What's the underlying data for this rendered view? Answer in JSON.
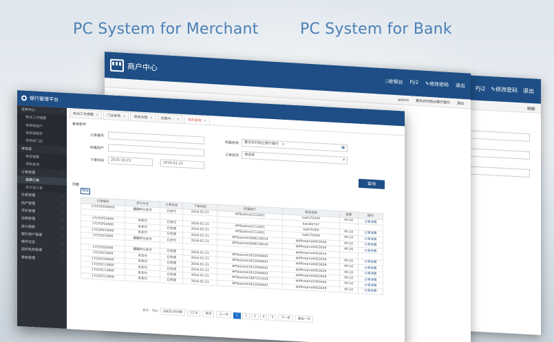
{
  "headings": {
    "merchant": "PC System for Merchant",
    "bank": "PC System for Bank"
  },
  "bank_window": {
    "top_links": [
      "Pji2",
      "✎修改密码",
      "退出"
    ],
    "refresh": "刷新"
  },
  "merchant_window": {
    "title": "商户中心",
    "top_links": [
      "⍈收银台",
      "Pji2",
      "✎修改密码",
      "退出"
    ],
    "strip_user": "admin",
    "strip_bank": "重庆农村商业银行银行",
    "strip_exit": "退出"
  },
  "platform": {
    "title": "银行管理平台",
    "sidebar": [
      {
        "label": "任务中心",
        "type": "group"
      },
      {
        "label": "电话工作提醒",
        "type": "sub"
      },
      {
        "label": "待审核商户",
        "type": "sub"
      },
      {
        "label": "待审核服务",
        "type": "sub"
      },
      {
        "label": "待审核门店",
        "type": "sub"
      },
      {
        "label": "审核提",
        "type": "group"
      },
      {
        "label": "审核提醒",
        "type": "sub"
      },
      {
        "label": "退款查询",
        "type": "sub"
      },
      {
        "label": "订单管理",
        "type": "group"
      },
      {
        "label": "逾期订单",
        "type": "sub",
        "active": true
      },
      {
        "label": "支付宝订单",
        "type": "sub"
      },
      {
        "label": "交易管理",
        "type": "group"
      },
      {
        "label": "商户管理",
        "type": "group"
      },
      {
        "label": "评价管理",
        "type": "group"
      },
      {
        "label": "店面管理",
        "type": "group"
      },
      {
        "label": "统计报表",
        "type": "group"
      },
      {
        "label": "银行用户管理",
        "type": "group"
      },
      {
        "label": "操作日志",
        "type": "group"
      },
      {
        "label": "组织机构管理",
        "type": "group"
      },
      {
        "label": "角色管理",
        "type": "group"
      }
    ],
    "tabs": [
      {
        "label": "电话工作提醒",
        "active": false
      },
      {
        "label": "门店审核",
        "active": false
      },
      {
        "label": "审核流程",
        "active": false
      },
      {
        "label": "加载中...",
        "active": false
      },
      {
        "label": "综合查询",
        "active": true
      }
    ],
    "search": {
      "section": "查询条件",
      "order_no_label": "订单编号",
      "merchant_label": "所属商户",
      "time_label": "下单时间",
      "start_date": "2015-10-23",
      "end_date": "2016-01-21",
      "org_label": "所属机构",
      "org_value": "重庆农村商业银行银行",
      "status_label": "订单状态",
      "status_value": "请选择",
      "query_btn": "查询"
    },
    "list": {
      "section": "列表",
      "export_btn": "导出",
      "columns": [
        "订单编号",
        "支付方式",
        "订单状态",
        "下单时间",
        "所属商户",
        "商品名称",
        "金额",
        "操作"
      ],
      "rows": [
        [
          "17CF5P039000",
          "翻翻时分支付",
          "已支付",
          "2016-01-21",
          "APSbatme2112001",
          "batl170204",
          "¥0.20",
          "订单详情"
        ],
        [
          "",
          "",
          "",
          "",
          "",
          "bat365747",
          "",
          ""
        ],
        [
          "17CF5PC0000",
          "未支付",
          "已支付",
          "2016-01-21",
          "APSbatme2112001",
          "batl70204",
          "¥0.10",
          "订单详情"
        ],
        [
          "17CF5P03000",
          "未支付",
          "已完成",
          "2016-01-21",
          "APSbatme2112001",
          "batl170204",
          "¥0.10",
          "订单详情"
        ],
        [
          "17CD0053000",
          "未支付",
          "已完成",
          "2016-01-21",
          "APSbosme2006130014",
          "apl6osqmo0423030",
          "¥0.10",
          "订单详情"
        ],
        [
          "17CD3C0000",
          "翻翻时分支付",
          "已支付",
          "2016-01-21",
          "APSbosme2006130014",
          "apl6osqmo0423030",
          "¥0.20",
          "订单详情"
        ],
        [
          "",
          "",
          "",
          "",
          "",
          "apl6osqmo0423015",
          "",
          ""
        ],
        [
          "17CD3Q3000",
          "翻翻时分支付",
          "已完成",
          "2016-01-21",
          "APSbosme1912044443",
          "apl6osqmo0423029",
          "¥0.10",
          "订单详情"
        ],
        [
          "17CD5C0000",
          "未支付",
          "已完成",
          "2016-01-21",
          "APSbosme1912044443",
          "apl6osqmo0423029",
          "¥0.10",
          "订单详情"
        ],
        [
          "17CD5C00000",
          "未支付",
          "已完成",
          "2016-01-21",
          "APSbosme1912044443",
          "apl6osqmo0423029",
          "¥0.10",
          "订单详情"
        ],
        [
          "17CD5C12800",
          "未支付",
          "已完成",
          "2016-01-21",
          "APSbosme1912044443",
          "apl6osqmo0423029",
          "¥0.10",
          "订单详情"
        ],
        [
          "17CD5C12800",
          "未支付",
          "已完成",
          "2016-01-21",
          "APSbosme1987211529",
          "apl6osqmo1043444",
          "¥0.10",
          "订单详情"
        ],
        [
          "17CD5C12800",
          "未支付",
          "已完成",
          "2016-01-21",
          "APSbosme1912044443",
          "apl6osqmo0423029",
          "¥0.10",
          "订单详情"
        ]
      ]
    },
    "pager": {
      "total": "总计：7tm",
      "current": "当前页/总页数",
      "count": "117b",
      "first": "首页",
      "prev": "上一页",
      "pages": [
        "1",
        "2",
        "3",
        "4",
        "5"
      ],
      "current_page": "1",
      "next": "下一页",
      "last": "最后一页"
    }
  }
}
